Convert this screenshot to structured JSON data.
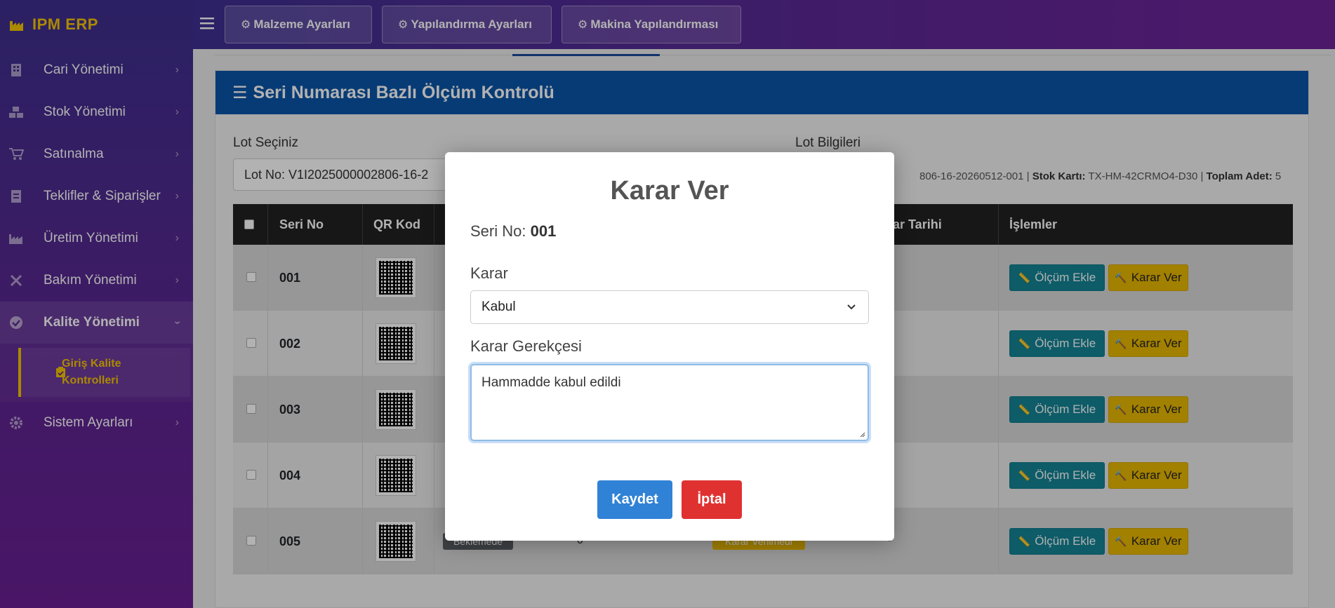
{
  "app": {
    "brand": "IPM ERP",
    "brand_color": "#f5c400"
  },
  "sidebar": {
    "items": [
      {
        "label": "Cari Yönetimi",
        "icon": "building-icon"
      },
      {
        "label": "Stok Yönetimi",
        "icon": "boxes-icon"
      },
      {
        "label": "Satınalma",
        "icon": "cart-icon"
      },
      {
        "label": "Teklifler & Siparişler",
        "icon": "invoice-icon"
      },
      {
        "label": "Üretim Yönetimi",
        "icon": "industry-icon"
      },
      {
        "label": "Bakım Yönetimi",
        "icon": "tools-icon"
      },
      {
        "label": "Kalite Yönetimi",
        "icon": "check-circle-icon"
      },
      {
        "label": "Sistem Ayarları",
        "icon": "gear-icon"
      }
    ],
    "subitem": {
      "label_line1": "Giriş Kalite",
      "label_line2": "Kontrolleri"
    }
  },
  "topbar": {
    "buttons": [
      {
        "label": "Malzeme Ayarları",
        "glyph": "⚙"
      },
      {
        "label": "Yapılandırma Ayarları",
        "glyph": "⚙"
      },
      {
        "label": "Makina Yapılandırması",
        "glyph": "⚙"
      }
    ]
  },
  "card": {
    "title": "Seri Numarası Bazlı Ölçüm Kontrolü",
    "lot_label": "Lot Seçiniz",
    "lot_value": "Lot No: V1I2025000002806-16-2",
    "lot_info_label": "Lot Bilgileri",
    "lot_info": {
      "lot_tail": "806-16-20260512-001 | ",
      "stock_label": "Stok Kartı:",
      "stock_value": " TX-HM-42CRMO4-D30 | ",
      "total_label": "Toplam Adet:",
      "total_value": " 5"
    }
  },
  "table": {
    "headers": {
      "serial": "Seri No",
      "qr": "QR Kod",
      "decision_date": "rar Tarihi",
      "actions": "İşlemler"
    },
    "rows": [
      {
        "serial": "001"
      },
      {
        "serial": "002"
      },
      {
        "serial": "003"
      },
      {
        "serial": "004"
      },
      {
        "serial": "005",
        "status": "Beklemede",
        "count": "0",
        "decision": "Karar Verilmedi",
        "date": "-"
      }
    ],
    "btn_measure": "Ölçüm Ekle",
    "btn_decide": "Karar Ver"
  },
  "modal": {
    "title": "Karar Ver",
    "serial_label": "Seri No: ",
    "serial_value": "001",
    "decision_label": "Karar",
    "decision_value": "Kabul",
    "reason_label": "Karar Gerekçesi",
    "reason_value": "Hammadde kabul edildi",
    "save": "Kaydet",
    "cancel": "İptal"
  }
}
